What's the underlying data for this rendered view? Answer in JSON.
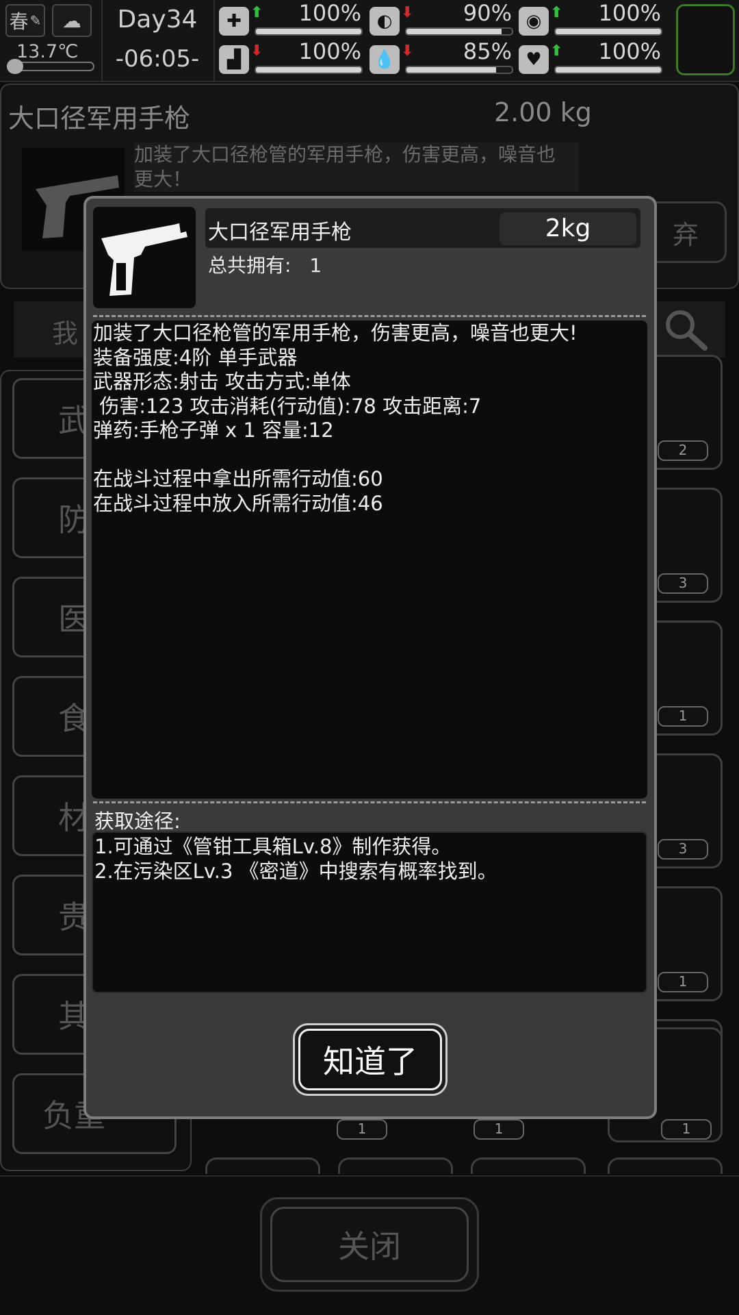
{
  "status": {
    "season": "春",
    "temperature": "13.7℃",
    "day": "Day34",
    "time": "-06:05-",
    "stats": [
      {
        "icon": "medkit-icon",
        "glyph": "✚",
        "trend": "up",
        "value": "100%",
        "fill": 1.0
      },
      {
        "icon": "stomach-icon",
        "glyph": "◐",
        "trend": "down",
        "value": "90%",
        "fill": 0.9
      },
      {
        "icon": "mind-icon",
        "glyph": "◉",
        "trend": "up",
        "value": "100%",
        "fill": 1.0
      },
      {
        "icon": "boot-icon",
        "glyph": "▟",
        "trend": "down",
        "value": "100%",
        "fill": 1.0
      },
      {
        "icon": "water-drop-icon",
        "glyph": "💧",
        "trend": "down",
        "value": "85%",
        "fill": 0.85
      },
      {
        "icon": "heart-icon",
        "glyph": "♥",
        "trend": "up",
        "value": "100%",
        "fill": 1.0
      }
    ]
  },
  "background": {
    "item_name": "大口径军用手枪",
    "item_weight": "2.00 kg",
    "item_desc_line1": "加装了大口径枪管的军用手枪，伤害更高，噪音也",
    "item_desc_line2": "更大！",
    "discard_label": "弃",
    "search_label": "我",
    "categories": [
      "武",
      "防",
      "医",
      "食",
      "材",
      "贵",
      "其",
      "负重"
    ],
    "slot_counts": [
      "2",
      "3",
      "1",
      "3",
      "1",
      "1"
    ],
    "bottom_counts": [
      "1",
      "1",
      "1"
    ],
    "close_label": "关闭"
  },
  "modal": {
    "item_name": "大口径军用手枪",
    "weight": "2kg",
    "owned_label": "总共拥有:",
    "owned_value": "1",
    "info_lines": [
      "加装了大口径枪管的军用手枪，伤害更高，噪音也更大!",
      "装备强度:4阶 单手武器",
      "武器形态:射击 攻击方式:单体",
      " 伤害:123 攻击消耗(行动值):78 攻击距离:7",
      "弹药:手枪子弹 x 1 容量:12",
      "",
      "在战斗过程中拿出所需行动值:60",
      "在战斗过程中放入所需行动值:46"
    ],
    "source_title": "获取途径:",
    "source_lines": [
      "1.可通过《管钳工具箱Lv.8》制作获得。",
      "2.在污染区Lv.3 《密道》中搜索有概率找到。"
    ],
    "ok_label": "知道了"
  },
  "colors": {
    "arrow_up": "#2fbf3a",
    "arrow_down": "#d22a2a",
    "accent_green": "#3f7a2a"
  }
}
